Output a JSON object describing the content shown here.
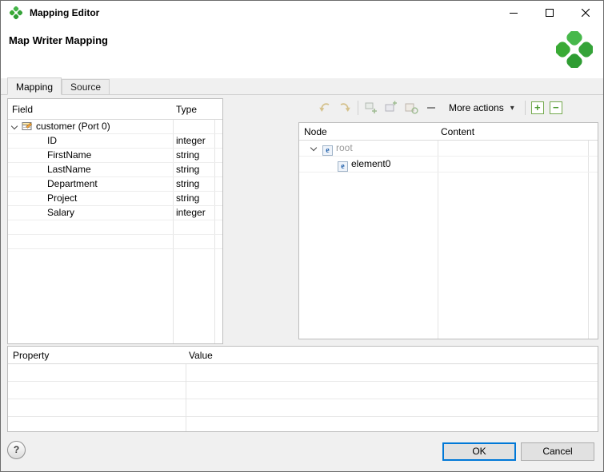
{
  "window": {
    "title": "Mapping Editor",
    "heading": "Map Writer Mapping"
  },
  "tabs": [
    {
      "label": "Mapping"
    },
    {
      "label": "Source"
    }
  ],
  "field_table": {
    "columns": [
      "Field",
      "Type"
    ],
    "group_label": "customer (Port 0)",
    "rows": [
      {
        "field": "ID",
        "type": "integer"
      },
      {
        "field": "FirstName",
        "type": "string"
      },
      {
        "field": "LastName",
        "type": "string"
      },
      {
        "field": "Department",
        "type": "string"
      },
      {
        "field": "Project",
        "type": "string"
      },
      {
        "field": "Salary",
        "type": "integer"
      }
    ]
  },
  "toolbar": {
    "more_actions": "More actions",
    "dropdown_arrow": "▾",
    "expand_all": "+",
    "collapse_all": "−"
  },
  "node_table": {
    "columns": [
      "Node",
      "Content"
    ],
    "rows": [
      {
        "label": "root"
      },
      {
        "label": "element0"
      }
    ]
  },
  "property_table": {
    "columns": [
      "Property",
      "Value"
    ]
  },
  "footer": {
    "help": "?",
    "ok": "OK",
    "cancel": "Cancel"
  },
  "colors": {
    "brand_green": "#3aaa35",
    "focus_blue": "#0078d7"
  }
}
